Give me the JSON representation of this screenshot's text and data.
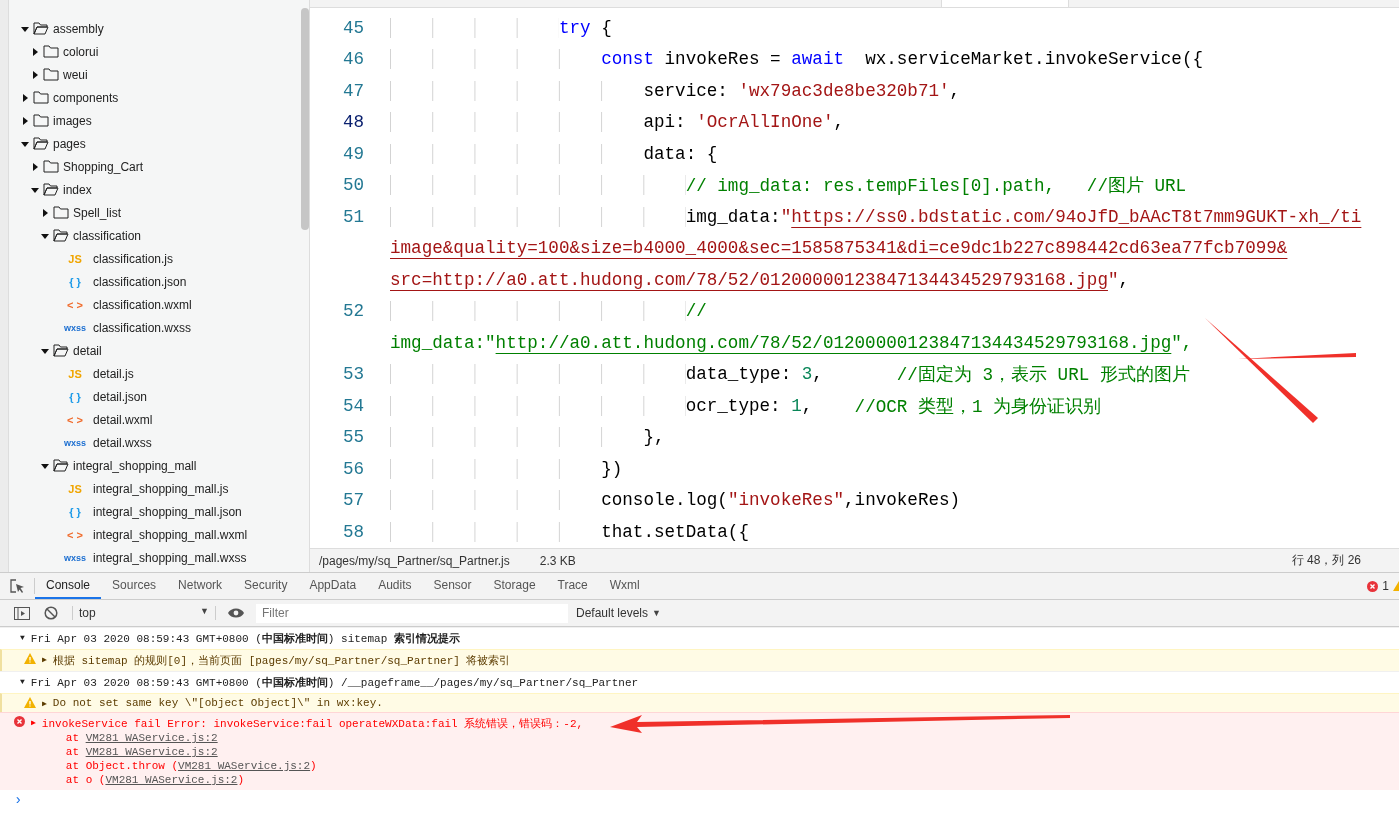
{
  "sidebar": {
    "tree": [
      {
        "kind": "folder",
        "label": "assembly",
        "expanded": true,
        "children": [
          {
            "kind": "folder",
            "label": "colorui",
            "expanded": false
          },
          {
            "kind": "folder",
            "label": "weui",
            "expanded": false
          }
        ]
      },
      {
        "kind": "folder",
        "label": "components",
        "expanded": false
      },
      {
        "kind": "folder",
        "label": "images",
        "expanded": false
      },
      {
        "kind": "folder",
        "label": "pages",
        "expanded": true,
        "children": [
          {
            "kind": "folder",
            "label": "Shopping_Cart",
            "expanded": false
          },
          {
            "kind": "folder",
            "label": "index",
            "expanded": true,
            "children": [
              {
                "kind": "folder",
                "label": "Spell_list",
                "expanded": false
              },
              {
                "kind": "folder",
                "label": "classification",
                "expanded": true,
                "children": [
                  {
                    "kind": "js",
                    "icon": "JS",
                    "label": "classification.js"
                  },
                  {
                    "kind": "json",
                    "icon": "{ }",
                    "label": "classification.json"
                  },
                  {
                    "kind": "wxml",
                    "icon": "< >",
                    "label": "classification.wxml"
                  },
                  {
                    "kind": "wxss",
                    "icon": "wxss",
                    "label": "classification.wxss"
                  }
                ]
              },
              {
                "kind": "folder",
                "label": "detail",
                "expanded": true,
                "children": [
                  {
                    "kind": "js",
                    "icon": "JS",
                    "label": "detail.js"
                  },
                  {
                    "kind": "json",
                    "icon": "{ }",
                    "label": "detail.json"
                  },
                  {
                    "kind": "wxml",
                    "icon": "< >",
                    "label": "detail.wxml"
                  },
                  {
                    "kind": "wxss",
                    "icon": "wxss",
                    "label": "detail.wxss"
                  }
                ]
              },
              {
                "kind": "folder",
                "label": "integral_shopping_mall",
                "expanded": true,
                "children": [
                  {
                    "kind": "js",
                    "icon": "JS",
                    "label": "integral_shopping_mall.js"
                  },
                  {
                    "kind": "json",
                    "icon": "{ }",
                    "label": "integral_shopping_mall.json"
                  },
                  {
                    "kind": "wxml",
                    "icon": "< >",
                    "label": "integral_shopping_mall.wxml"
                  },
                  {
                    "kind": "wxss",
                    "icon": "wxss",
                    "label": "integral_shopping_mall.wxss"
                  }
                ]
              }
            ]
          }
        ]
      }
    ]
  },
  "editor": {
    "rows": [
      {
        "number": "45",
        "current": false,
        "tokens": [
          {
            "kind": "kw",
            "text": "                try"
          },
          {
            "kind": "plain",
            "text": " {"
          }
        ]
      },
      {
        "number": "46",
        "current": false,
        "tokens": [
          {
            "kind": "kw",
            "text": "                    const"
          },
          {
            "kind": "plain",
            "text": " invokeRes = "
          },
          {
            "kind": "kw",
            "text": "await"
          },
          {
            "kind": "plain",
            "text": "  wx.serviceMarket.invokeService({"
          }
        ]
      },
      {
        "number": "47",
        "current": false,
        "tokens": [
          {
            "kind": "plain",
            "text": "                        service: "
          },
          {
            "kind": "str",
            "text": "'wx79ac3de8be320b71'"
          },
          {
            "kind": "plain",
            "text": ","
          }
        ]
      },
      {
        "number": "48",
        "current": true,
        "tokens": [
          {
            "kind": "plain",
            "text": "                        api: "
          },
          {
            "kind": "str",
            "text": "'OcrAllInOne'"
          },
          {
            "kind": "plain",
            "text": ","
          }
        ]
      },
      {
        "number": "49",
        "current": false,
        "tokens": [
          {
            "kind": "plain",
            "text": "                        data: {"
          }
        ]
      },
      {
        "number": "50",
        "current": false,
        "tokens": [
          {
            "kind": "cmt",
            "text": "                            // img_data: res.tempFiles[0].path,   //图片 URL"
          }
        ]
      },
      {
        "number": "51",
        "current": false,
        "tokens": [
          {
            "kind": "plain",
            "text": "                            img_data:"
          },
          {
            "kind": "str",
            "text": "\""
          },
          {
            "kind": "strlink",
            "text": "https://ss0.bdstatic.com/94oJfD_bAAcT8t7mm9GUKT-xh_/ti"
          }
        ]
      },
      {
        "tokens": [
          {
            "kind": "strlink",
            "text": "image&quality=100&size=b4000_4000&sec=1585875341&di=ce9dc1b227c898442cd63ea77fcb7099&"
          }
        ]
      },
      {
        "tokens": [
          {
            "kind": "strlink",
            "text": "src=http://a0.att.hudong.com/78/52/01200000123847134434529793168.jpg"
          },
          {
            "kind": "str",
            "text": "\""
          },
          {
            "kind": "plain",
            "text": ","
          }
        ]
      },
      {
        "number": "52",
        "current": false,
        "tokens": [
          {
            "kind": "cmt",
            "text": "                            //"
          }
        ]
      },
      {
        "tokens": [
          {
            "kind": "cmt",
            "text": "img_data:\""
          },
          {
            "kind": "cmtlink",
            "text": "http://a0.att.hudong.com/78/52/01200000123847134434529793168.jpg"
          },
          {
            "kind": "cmt",
            "text": "\","
          }
        ]
      },
      {
        "number": "53",
        "current": false,
        "tokens": [
          {
            "kind": "plain",
            "text": "                            data_type: "
          },
          {
            "kind": "num",
            "text": "3"
          },
          {
            "kind": "plain",
            "text": ",       "
          },
          {
            "kind": "cmt",
            "text": "//固定为 3，表示 URL 形式的图片"
          }
        ]
      },
      {
        "number": "54",
        "current": false,
        "tokens": [
          {
            "kind": "plain",
            "text": "                            ocr_type: "
          },
          {
            "kind": "num",
            "text": "1"
          },
          {
            "kind": "plain",
            "text": ",    "
          },
          {
            "kind": "cmt",
            "text": "//OCR 类型，1 为身份证识别"
          }
        ]
      },
      {
        "number": "55",
        "current": false,
        "tokens": [
          {
            "kind": "plain",
            "text": "                        },"
          }
        ]
      },
      {
        "number": "56",
        "current": false,
        "tokens": [
          {
            "kind": "plain",
            "text": "                    })"
          }
        ]
      },
      {
        "number": "57",
        "current": false,
        "tokens": [
          {
            "kind": "plain",
            "text": "                    console.log("
          },
          {
            "kind": "str",
            "text": "\"invokeRes\""
          },
          {
            "kind": "plain",
            "text": ",invokeRes)"
          }
        ]
      },
      {
        "number": "58",
        "current": false,
        "tokens": [
          {
            "kind": "plain",
            "text": "                    that.setData({"
          }
        ]
      }
    ]
  },
  "status_bar": {
    "path": "/pages/my/sq_Partner/sq_Partner.js",
    "size": "2.3 KB",
    "position": "行 48，列 26"
  },
  "devtools": {
    "tabs": [
      {
        "label": "Console",
        "selected": true
      },
      {
        "label": "Sources",
        "selected": false
      },
      {
        "label": "Network",
        "selected": false
      },
      {
        "label": "Security",
        "selected": false
      },
      {
        "label": "AppData",
        "selected": false
      },
      {
        "label": "Audits",
        "selected": false
      },
      {
        "label": "Sensor",
        "selected": false
      },
      {
        "label": "Storage",
        "selected": false
      },
      {
        "label": "Trace",
        "selected": false
      },
      {
        "label": "Wxml",
        "selected": false
      }
    ],
    "error_count": "1",
    "context": "top",
    "context_caret": "▼",
    "filter": {
      "placeholder": "Filter"
    },
    "levels": "Default levels",
    "levels_caret": "▼",
    "messages": [
      {
        "kind": "group",
        "toggle": "▼",
        "text": "Fri Apr 03 2020 08:59:43 GMT+0800 (**中国标准时间**) sitemap **索引情况提示**"
      },
      {
        "kind": "warning",
        "toggle": "▶",
        "text": "根据 sitemap 的规则[0]，当前页面 [pages/my/sq_Partner/sq_Partner] 将被索引"
      },
      {
        "kind": "group",
        "toggle": "▼",
        "text": "Fri Apr 03 2020 08:59:43 GMT+0800 (**中国标准时间**) /__pageframe__/pages/my/sq_Partner/sq_Partner"
      },
      {
        "kind": "warning",
        "toggle": "▶",
        "text": "Do not set same key \\\"[object Object]\\\" in wx:key."
      },
      {
        "kind": "error",
        "toggle": "▶",
        "text": "invokeService fail Error: invokeService:fail operateWXData:fail 系统错误，错误码：-2,",
        "stack": [
          {
            "prefix": "at ",
            "link": "VM281 WAService.js:2"
          },
          {
            "prefix": "at ",
            "link": "VM281 WAService.js:2"
          },
          {
            "prefix": "at Object.throw (",
            "link": "VM281 WAService.js:2",
            "suffix": ")"
          },
          {
            "prefix": "at o (",
            "link": "VM281 WAService.js:2",
            "suffix": ")"
          }
        ]
      }
    ],
    "prompt": "›"
  }
}
